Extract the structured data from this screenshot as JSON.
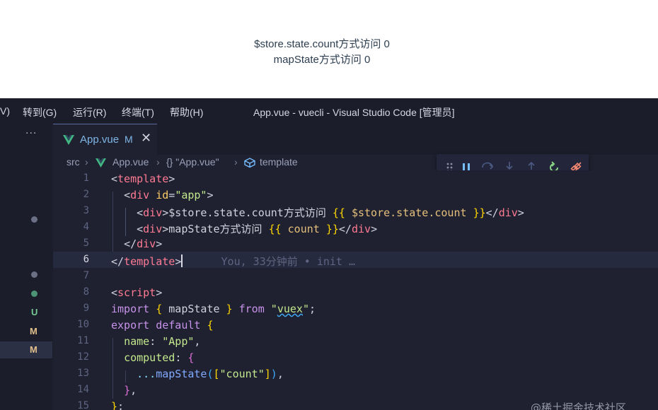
{
  "preview": {
    "line1": "$store.state.count方式访问 0",
    "line2": "mapState方式访问 0"
  },
  "titlebar": {
    "menu": [
      "V)",
      "转到(G)",
      "运行(R)",
      "终端(T)",
      "帮助(H)"
    ],
    "title": "App.vue - vuecli - Visual Studio Code [管理员]"
  },
  "activitybar": {
    "more": "···",
    "decorations": [
      "U",
      "M",
      "M"
    ],
    "colors": {
      "dot": "#6c7086",
      "green_dot": "#4d9375"
    }
  },
  "tab": {
    "label": "App.vue",
    "modified": "M",
    "close": "✕"
  },
  "breadcrumb": {
    "items": [
      "src",
      "App.vue",
      "{} \"App.vue\"",
      "template"
    ]
  },
  "debug_toolbar": {
    "icons": [
      "drag-handle-icon",
      "pause-icon",
      "step-over-icon",
      "step-into-icon",
      "step-out-icon",
      "restart-icon",
      "disconnect-icon"
    ]
  },
  "editor": {
    "line_numbers": [
      "1",
      "2",
      "3",
      "4",
      "5",
      "6",
      "7",
      "8",
      "9",
      "10",
      "11",
      "12",
      "13",
      "14",
      "15"
    ],
    "current_line": "6",
    "blame": "You, 33分钟前 • init …",
    "tokens": {
      "l1": [
        "<",
        "template",
        ">"
      ],
      "l2": [
        "<",
        "div",
        " ",
        "id",
        "=",
        "\"app\"",
        ">"
      ],
      "l3": [
        "<",
        "div",
        ">",
        "$store.state.count方式访问 ",
        "{{",
        " $store.state.count ",
        "}}",
        "</",
        "div",
        ">"
      ],
      "l4": [
        "<",
        "div",
        ">",
        "mapState方式访问 ",
        "{{",
        " count ",
        "}}",
        "</",
        "div",
        ">"
      ],
      "l5": [
        "</",
        "div",
        ">"
      ],
      "l6": [
        "</",
        "template",
        ">"
      ],
      "l8": [
        "<",
        "script",
        ">"
      ],
      "l9": [
        "import",
        " ",
        "{",
        " mapState ",
        "}",
        " ",
        "from",
        " ",
        "\"",
        "vuex",
        "\"",
        ";"
      ],
      "l10": [
        "export",
        " ",
        "default",
        " ",
        "{"
      ],
      "l11": [
        "name",
        ":",
        " ",
        "\"App\"",
        ","
      ],
      "l12": [
        "computed",
        ":",
        " ",
        "{"
      ],
      "l13": [
        "...",
        "mapState",
        "(",
        "[",
        "\"count\"",
        "]",
        ")",
        ","
      ],
      "l14": [
        "}",
        ","
      ],
      "l15": [
        "}",
        ";"
      ]
    }
  },
  "watermark": "@稀土掘金技术社区"
}
